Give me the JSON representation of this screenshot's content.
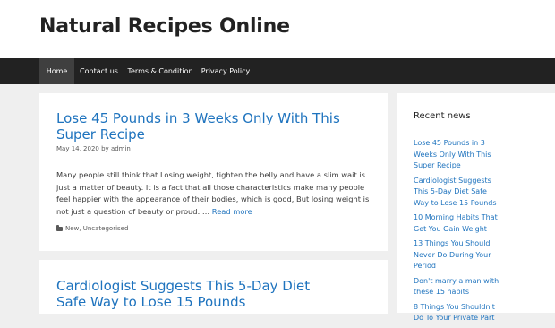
{
  "site": {
    "title": "Natural Recipes Online"
  },
  "nav": {
    "items": [
      {
        "label": "Home"
      },
      {
        "label": "Contact us"
      },
      {
        "label": "Terms & Condition"
      },
      {
        "label": "Privacy Policy"
      }
    ]
  },
  "posts": [
    {
      "title": "Lose 45 Pounds in 3 Weeks Only With This Super Recipe",
      "date": "May 14, 2020",
      "by": "by",
      "author": "admin",
      "excerpt": "Many people still think that Losing weight, tighten the belly and have a slim wait is just a matter of beauty. It is a fact that all those characteristics make many people feel happier with the appearance of their bodies, which is good, But losing weight is not just a question of beauty or proud. …",
      "read_more": "Read more",
      "categories": [
        "New",
        "Uncategorised"
      ],
      "category_separator": ", "
    },
    {
      "title": "Cardiologist Suggests This 5-Day Diet Safe Way to Lose 15 Pounds"
    }
  ],
  "sidebar": {
    "widget_title": "Recent news",
    "items": [
      {
        "label": "Lose 45 Pounds in 3 Weeks Only With This Super Recipe"
      },
      {
        "label": "Cardiologist Suggests This 5-Day Diet Safe Way to Lose 15 Pounds"
      },
      {
        "label": "10 Morning Habits That Get You Gain Weight"
      },
      {
        "label": "13 Things You Should Never Do During Your Period"
      },
      {
        "label": "Don't marry a man with these 15 habits"
      },
      {
        "label": "8 Things You Shouldn't Do To Your Private Part"
      }
    ]
  },
  "colors": {
    "link": "#1e73be",
    "nav_bg": "#222222",
    "nav_active": "#3f3f3f",
    "page_bg": "#efefef"
  }
}
